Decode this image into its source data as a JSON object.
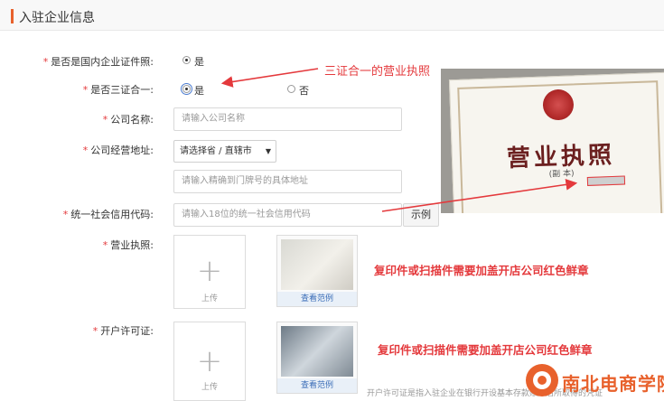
{
  "header": {
    "title": "入驻企业信息"
  },
  "fields": {
    "domestic_cert": {
      "label": "是否是国内企业证件照:",
      "option_yes": "是"
    },
    "three_in_one": {
      "label": "是否三证合一:",
      "option_yes": "是",
      "option_no": "否"
    },
    "company_name": {
      "label": "公司名称:",
      "placeholder": "请输入公司名称"
    },
    "company_address": {
      "label": "公司经营地址:",
      "region_select": "请选择省 / 直辖市",
      "detail_placeholder": "请输入精确到门牌号的具体地址"
    },
    "credit_code": {
      "label": "统一社会信用代码:",
      "placeholder": "请输入18位的统一社会信用代码",
      "example_button": "示例"
    },
    "business_license": {
      "label": "营业执照:",
      "upload_label": "上传",
      "sample_caption": "查看范例"
    },
    "bank_permit": {
      "label": "开户许可证:",
      "upload_label": "上传",
      "sample_caption": "查看范例"
    }
  },
  "annotations": {
    "three_in_one_note": "三证合一的营业执照",
    "stamp_note_1": "复印件或扫描件需要加盖开店公司红色鲜章",
    "stamp_note_2": "复印件或扫描件需要加盖开店公司红色鲜章"
  },
  "certificate": {
    "title": "营业执照",
    "subtitle": "(副 本)"
  },
  "footer": {
    "note": "开户许可证是指入驻企业在银行开设基本存款账户后所取得的凭证"
  },
  "logo": {
    "text": "南北电商学院"
  },
  "colors": {
    "required": "#e4393c",
    "accent": "#e8612c",
    "link": "#3a6db7"
  }
}
